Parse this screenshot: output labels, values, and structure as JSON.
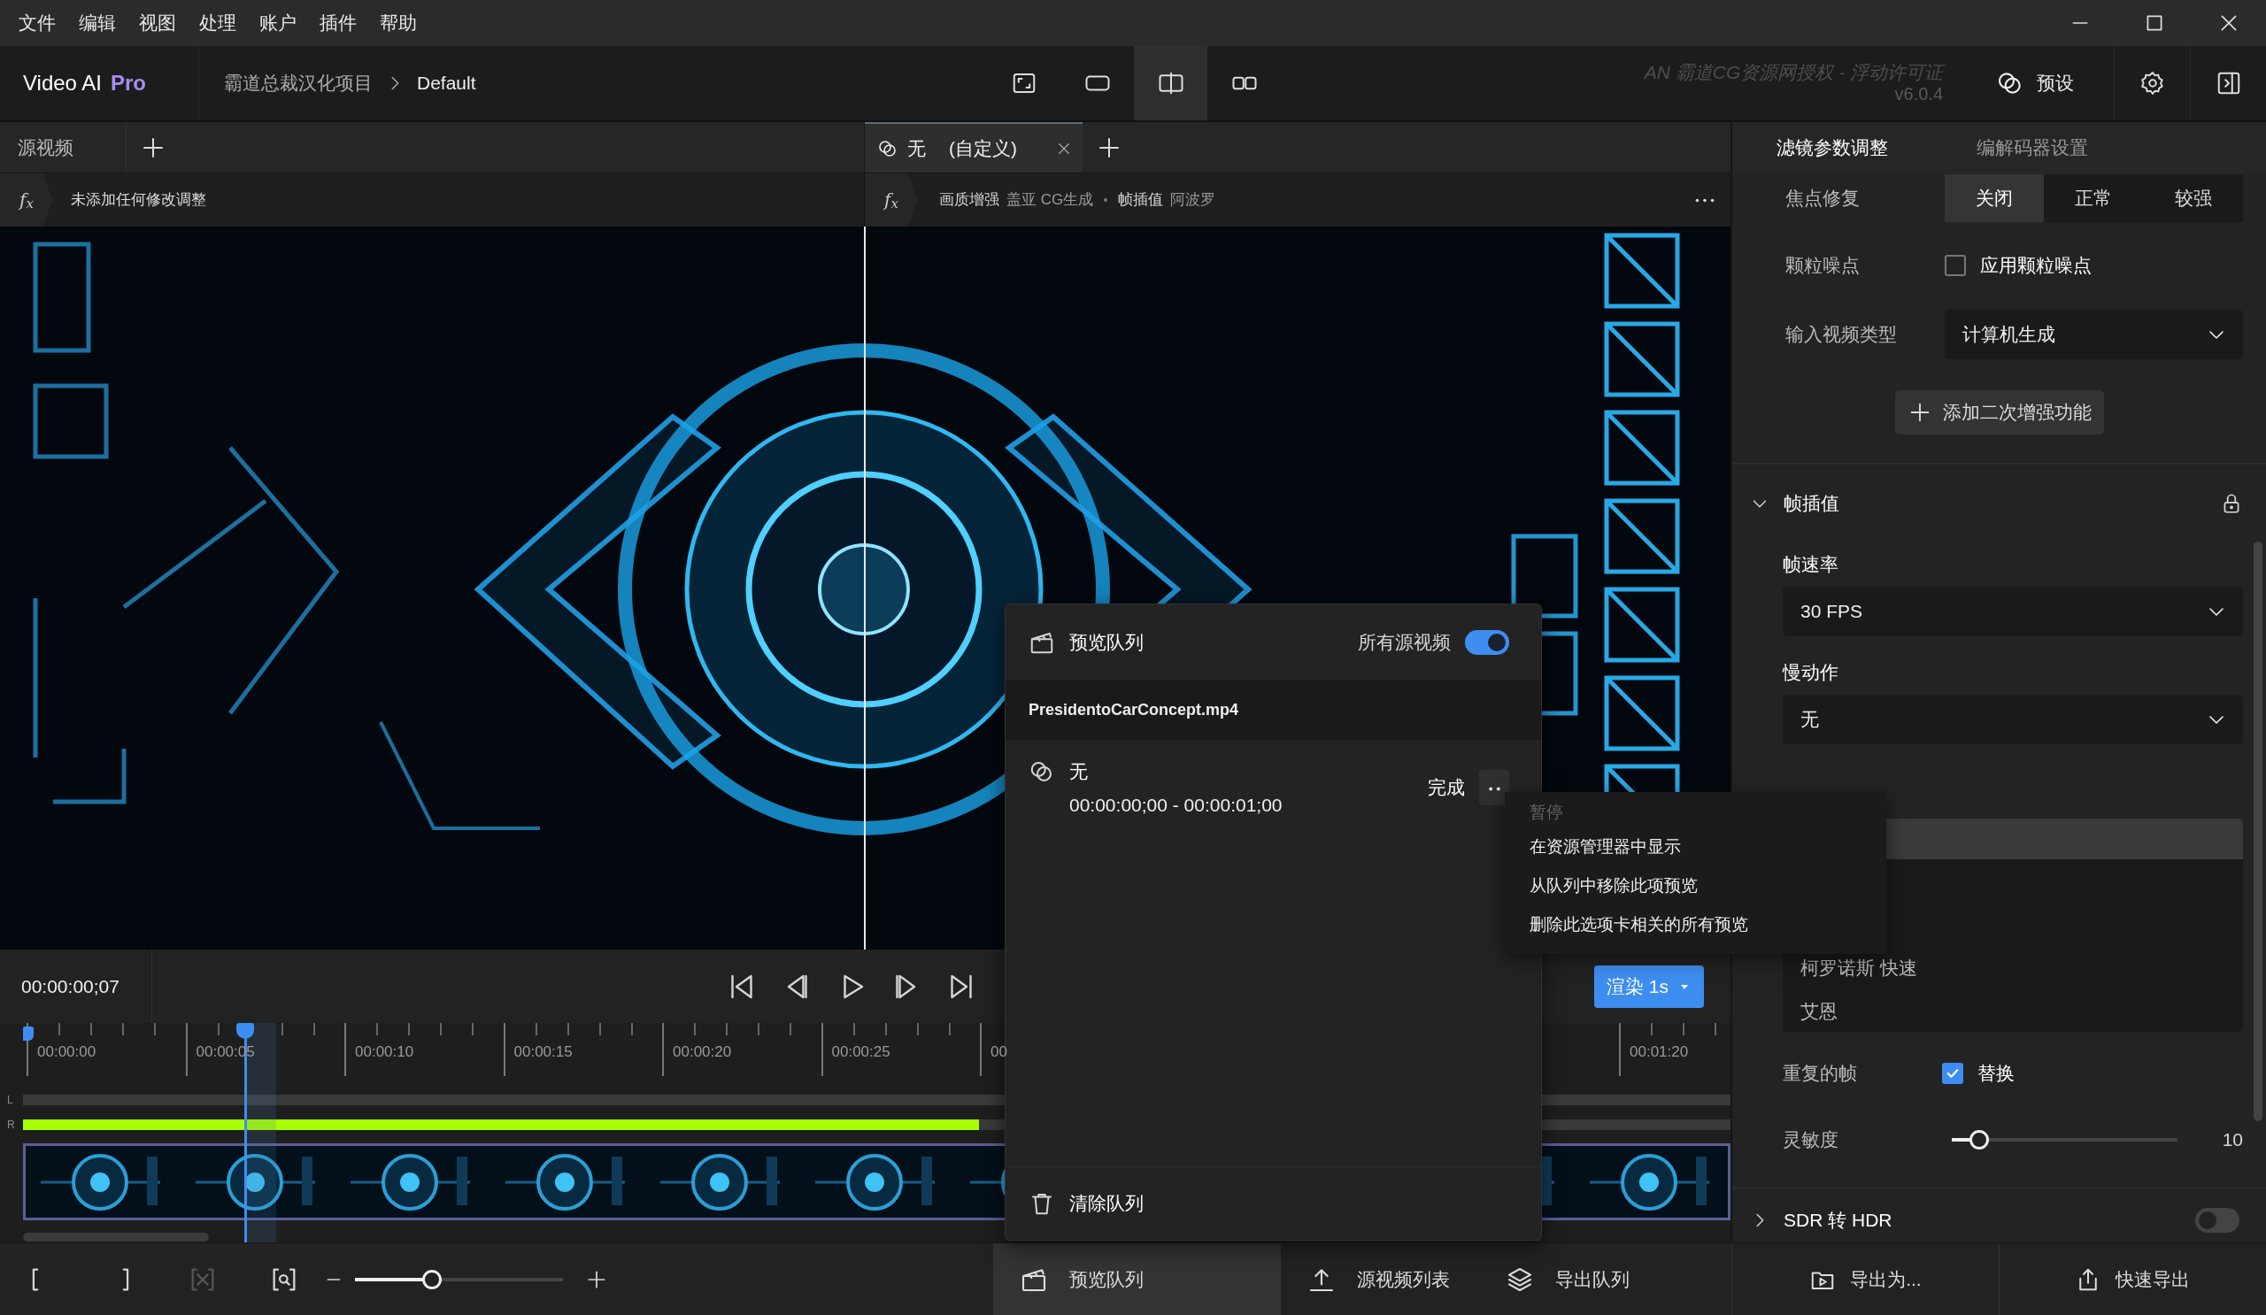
{
  "menu_bar": {
    "items": [
      "文件",
      "编辑",
      "视图",
      "处理",
      "账户",
      "插件",
      "帮助"
    ]
  },
  "header": {
    "app_name": "Video AI",
    "edition": "Pro",
    "breadcrumb": [
      "霸道总裁汉化项目",
      "Default"
    ],
    "view_modes": [
      {
        "kind": "single",
        "selected": false
      },
      {
        "kind": "wide",
        "selected": false
      },
      {
        "kind": "split",
        "selected": true
      },
      {
        "kind": "side",
        "selected": false
      }
    ],
    "license": "AN  霸道CG资源网授权 - 浮动许可证",
    "version": "v6.0.4",
    "presets_button": "预设"
  },
  "source_tab": {
    "label": "源视频"
  },
  "preview_tab": {
    "label": "无",
    "detail": "(自定义)"
  },
  "source_filters": {
    "symbol": "f$_{x}$",
    "text": "未添加任何修改调整"
  },
  "preview_filters": {
    "symbol": "f$_{x}$",
    "items": [
      {
        "name": "画质增强",
        "value": "盖亚 CG生成"
      },
      {
        "name": "帧插值",
        "value": "阿波罗"
      }
    ]
  },
  "transport": {
    "timecode": "00:00:00;07",
    "render_button": "渲染 1s"
  },
  "timeline": {
    "ticks": [
      "00:00:00",
      "00:00:05",
      "00:00:10",
      "00:00:15",
      "00:00:20",
      "00:00:25",
      "00"
    ],
    "end_tick": "00:01:20",
    "channels": [
      "L",
      "R"
    ]
  },
  "bottom_toolbar": {
    "clear_range": {
      "disabled": true
    },
    "zoom": {
      "level": 0.37
    }
  },
  "queue_tabs": [
    {
      "label": "预览队列",
      "selected": true
    },
    {
      "label": "源视频列表",
      "selected": false
    },
    {
      "label": "导出队列",
      "selected": false
    }
  ],
  "export_buttons": [
    "导出为...",
    "快速导出"
  ],
  "right_panel": {
    "tabs": [
      {
        "label": "滤镜参数调整",
        "selected": true
      },
      {
        "label": "编解码器设置",
        "selected": false
      }
    ],
    "focus_fix": {
      "label": "焦点修复",
      "options": [
        {
          "label": "关闭",
          "selected": true
        },
        {
          "label": "正常",
          "selected": false
        },
        {
          "label": "较强",
          "selected": false
        }
      ]
    },
    "grain": {
      "label": "颗粒噪点",
      "checkbox": "应用颗粒噪点",
      "checked": false
    },
    "input_type": {
      "label": "输入视频类型",
      "value": "计算机生成"
    },
    "add_button": "添加二次增强功能",
    "interpolation": {
      "title": "帧插值",
      "expanded": true
    },
    "frame_rate": {
      "label": "帧速率",
      "value": "30 FPS"
    },
    "slow_motion": {
      "label": "慢动作",
      "value": "无"
    },
    "ai_model_options": [
      {
        "selected": true
      },
      {
        "selected": false
      },
      {
        "selected": false
      },
      {
        "label": "柯罗诺斯 快速",
        "selected": false
      },
      {
        "label": "艾恩",
        "selected": false
      }
    ],
    "duplicate_frames": {
      "label": "重复的帧",
      "checkbox": "替换",
      "checked": true
    },
    "sensitivity": {
      "label": "灵敏度",
      "level": 0.12,
      "reading": "10"
    },
    "sdr_hdr": {
      "title": "SDR 转 HDR",
      "expanded": false,
      "on": false
    }
  },
  "preview_queue": {
    "title": "预览队列",
    "all_sources_label": "所有源视频",
    "all_sources_on": true,
    "file": "PresidentoCarConcept.mp4",
    "items": [
      {
        "name": "无",
        "range": "00:00:00;00 - 00:00:01;00",
        "status": "完成"
      }
    ],
    "clear_button": "清除队列"
  },
  "context_menu": {
    "items": [
      {
        "label": "暂停",
        "disabled": true
      },
      {
        "label": "在资源管理器中显示",
        "disabled": false
      },
      {
        "label": "从队列中移除此项预览",
        "disabled": false
      },
      {
        "label": "删除此选项卡相关的所有预览",
        "disabled": false
      }
    ]
  }
}
